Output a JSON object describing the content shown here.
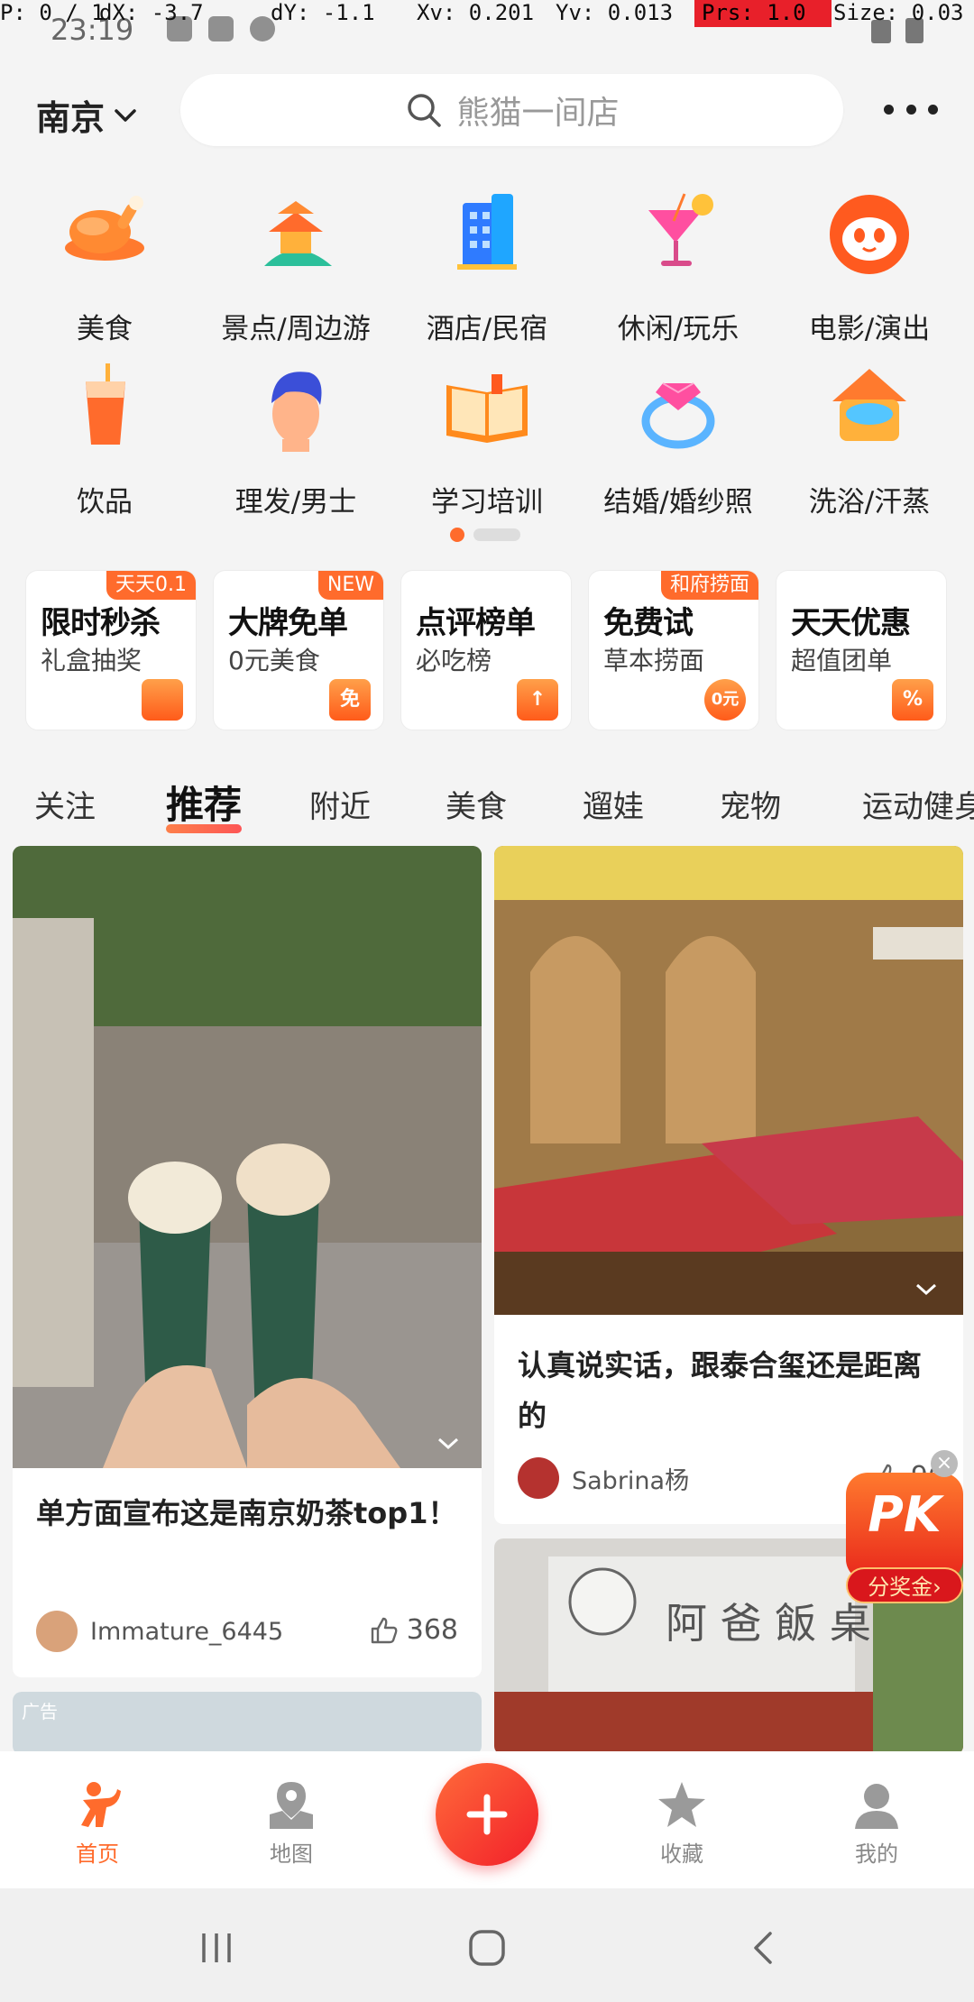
{
  "debug": {
    "pointer": "P: 0 / 1",
    "dx": "dX: -3.7",
    "dy": "dY: -1.1",
    "xv": "Xv: 0.201",
    "yv": "Yv: 0.013",
    "prs": "Prs: 1.0",
    "size": "Size: 0.03"
  },
  "status_bar": {
    "time": "23:19"
  },
  "header": {
    "city": "南京",
    "search_placeholder": "熊猫一间店"
  },
  "categories": [
    {
      "label": "美食",
      "icon": "roast-chicken-icon"
    },
    {
      "label": "景点/周边游",
      "icon": "pavilion-icon"
    },
    {
      "label": "酒店/民宿",
      "icon": "hotel-building-icon"
    },
    {
      "label": "休闲/玩乐",
      "icon": "cocktail-icon"
    },
    {
      "label": "电影/演出",
      "icon": "cat-face-icon"
    },
    {
      "label": "饮品",
      "icon": "drink-cup-icon"
    },
    {
      "label": "理发/男士",
      "icon": "barber-head-icon"
    },
    {
      "label": "学习培训",
      "icon": "open-book-icon"
    },
    {
      "label": "结婚/婚纱照",
      "icon": "diamond-ring-icon"
    },
    {
      "label": "洗浴/汗蒸",
      "icon": "bath-icon"
    }
  ],
  "promos": [
    {
      "title": "限时秒杀",
      "sub": "礼盒抽奖",
      "tag": "天天0.1",
      "badge": ""
    },
    {
      "title": "大牌免单",
      "sub": "0元美食",
      "tag": "NEW",
      "badge": "免"
    },
    {
      "title": "点评榜单",
      "sub": "必吃榜",
      "tag": "",
      "badge": "↑"
    },
    {
      "title": "免费试",
      "sub": "草本捞面",
      "tag": "和府捞面",
      "badge": "0元"
    },
    {
      "title": "天天优惠",
      "sub": "超值团单",
      "tag": "",
      "badge": "%"
    }
  ],
  "tabs": [
    "关注",
    "推荐",
    "附近",
    "美食",
    "遛娃",
    "宠物",
    "运动健身"
  ],
  "feed": {
    "left": {
      "title": "单方面宣布这是南京奶茶top1！",
      "user": "Immature_6445",
      "likes": "368"
    },
    "right": {
      "title": "认真说实话，跟泰合玺还是距离的",
      "user": "Sabrina杨",
      "likes": "96"
    },
    "ad_label": "广告",
    "pk": {
      "title": "PK",
      "sub": "分奖金›"
    }
  },
  "bottom_nav": {
    "home": "首页",
    "map": "地图",
    "favorites": "收藏",
    "mine": "我的"
  },
  "colors": {
    "accent": "#ff6b2c",
    "fab": "#f21f2a"
  }
}
